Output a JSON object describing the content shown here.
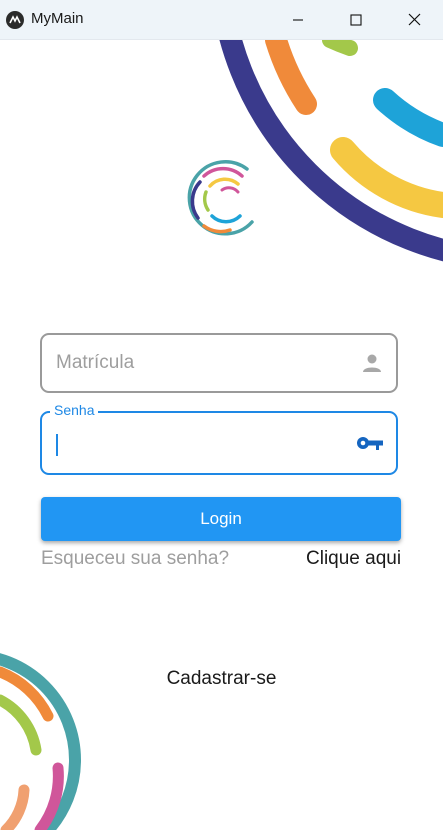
{
  "window": {
    "title": "MyMain",
    "minimize_icon": "minimize-icon",
    "maximize_icon": "maximize-icon",
    "close_icon": "close-icon"
  },
  "form": {
    "username": {
      "placeholder": "Matrícula",
      "value": "",
      "icon": "person-icon"
    },
    "password": {
      "label": "Senha",
      "value": "",
      "icon": "key-icon"
    },
    "login_label": "Login",
    "forgot_text": "Esqueceu sua senha?",
    "click_here": "Clique aqui",
    "signup_label": "Cadastrar-se"
  },
  "colors": {
    "accent": "#2196f3",
    "focus": "#1e88e5",
    "navy": "#3a3a8c",
    "teal": "#4aa3a8",
    "orange": "#f08a3a",
    "yellow": "#f5c842",
    "green": "#a3c84a",
    "sky": "#1ea3d8",
    "pink": "#d0569a"
  }
}
